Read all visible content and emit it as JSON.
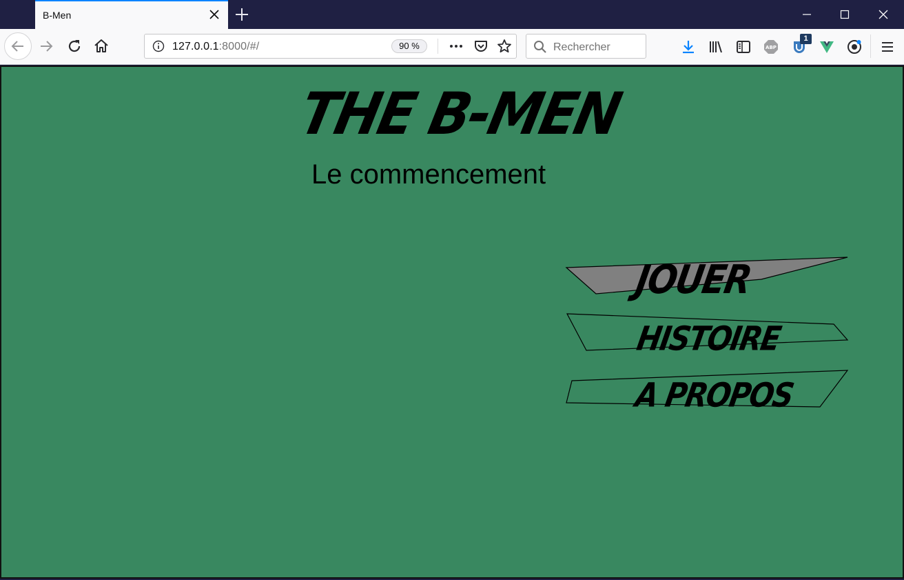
{
  "browser": {
    "tab_title": "B-Men",
    "url_host": "127.0.0.1",
    "url_rest": ":8000/#/",
    "zoom": "90 %",
    "search_placeholder": "Rechercher",
    "extension_badge_count": "1",
    "accent_color": "#0a84ff"
  },
  "page": {
    "background_color": "#398860",
    "title": "THE B-MEN",
    "subtitle": "Le commencement",
    "menu": [
      {
        "label": "JOUER",
        "fill": "#808080",
        "selected": true
      },
      {
        "label": "HISTOIRE",
        "fill": "none",
        "selected": false
      },
      {
        "label": "A PROPOS",
        "fill": "none",
        "selected": false
      }
    ]
  }
}
